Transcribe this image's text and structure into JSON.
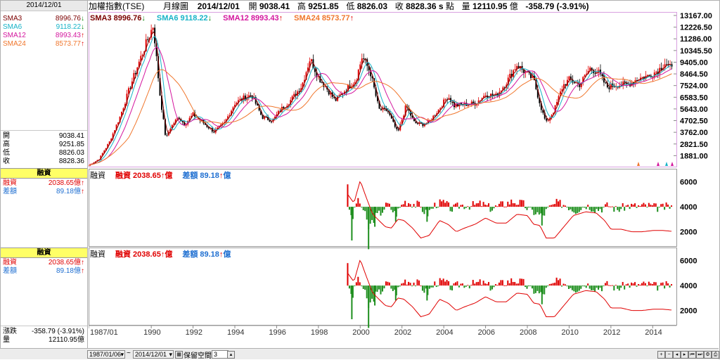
{
  "header": {
    "title": "加權指數(TSE)",
    "period": "月線圖",
    "date": "2014/12/01",
    "open_label": "開",
    "open": "9038.41",
    "high_label": "高",
    "high": "9251.85",
    "low_label": "低",
    "low": "8826.03",
    "close_label": "收",
    "close": "8828.36",
    "close_flag": "s",
    "unit": "點",
    "vol_label": "量",
    "vol": "12110.95",
    "vol_unit": "億",
    "change": "-358.79 (-3.91%)"
  },
  "legend_price": [
    {
      "label": "SMA3",
      "value": "8996.76",
      "dir": "down",
      "color": "#7b0000"
    },
    {
      "label": "SMA6",
      "value": "9118.22",
      "dir": "down",
      "color": "#17b3c7"
    },
    {
      "label": "SMA12",
      "value": "8993.43",
      "dir": "up",
      "color": "#d4169e"
    },
    {
      "label": "SMA24",
      "value": "8573.77",
      "dir": "up",
      "color": "#f0762c"
    }
  ],
  "left_panel": {
    "date": "2014/12/01",
    "sma": [
      {
        "label": "SMA3",
        "value": "8996.76",
        "dir": "down",
        "color": "#7b0000"
      },
      {
        "label": "SMA6",
        "value": "9118.22",
        "dir": "down",
        "color": "#17b3c7"
      },
      {
        "label": "SMA12",
        "value": "8993.43",
        "dir": "up",
        "color": "#d4169e"
      },
      {
        "label": "SMA24",
        "value": "8573.77",
        "dir": "up",
        "color": "#f0762c"
      }
    ],
    "ohlc": [
      {
        "label": "開",
        "value": "9038.41"
      },
      {
        "label": "高",
        "value": "9251.85"
      },
      {
        "label": "低",
        "value": "8826.03"
      },
      {
        "label": "收",
        "value": "8828.36"
      }
    ],
    "margin_box": "融資",
    "margin_rows": [
      {
        "label": "融資",
        "value": "2038.65億",
        "dir": "up",
        "color": "#e00000"
      },
      {
        "label": "差額",
        "value": "89.18億",
        "dir": "up",
        "color": "#1f6fd1"
      }
    ],
    "change_label": "漲跌",
    "change_value": "-358.79 (-3.91%)",
    "vol_label": "量",
    "vol_value": "12110.95億"
  },
  "sub_legend": {
    "name": "融資",
    "item1_label": "融資",
    "item1_value": "2038.65",
    "item2_label": "差額",
    "item2_value": "89.18",
    "unit": "億"
  },
  "price_axis": [
    "13167.00",
    "12226.50",
    "11286.00",
    "10345.50",
    "9405.00",
    "8464.50",
    "7524.00",
    "6583.50",
    "5643.00",
    "4702.50",
    "3762.00",
    "2821.50",
    "1881.00"
  ],
  "sub_axis": [
    "6000",
    "4000",
    "2000"
  ],
  "x_axis": [
    "1987/01",
    "1990",
    "1992",
    "1994",
    "1996",
    "1998",
    "2000",
    "2002",
    "2004",
    "2006",
    "2008",
    "2010",
    "2012",
    "2014"
  ],
  "bottom_bar": {
    "start_date": "1987/01/06",
    "sep": "~",
    "end_date": "2014/12/01",
    "space_label": "保留空間",
    "space_value": "3"
  },
  "chart_data": [
    {
      "type": "candlestick",
      "title": "加權指數(TSE) 月線圖",
      "ylim": [
        940,
        13450
      ],
      "x_range": [
        "1987/01",
        "2014/12"
      ],
      "series": [
        {
          "name": "price_close",
          "x": [
            1987.0,
            1987.5,
            1988.0,
            1988.5,
            1989.0,
            1989.5,
            1990.1,
            1990.4,
            1990.7,
            1990.9,
            1991.3,
            1991.6,
            1992.0,
            1992.5,
            1993.0,
            1993.5,
            1994.0,
            1994.4,
            1994.8,
            1995.3,
            1995.8,
            1996.2,
            1996.7,
            1997.2,
            1997.6,
            1998.0,
            1998.4,
            1998.8,
            1999.3,
            1999.8,
            2000.1,
            2000.5,
            2000.9,
            2001.3,
            2001.8,
            2002.2,
            2002.6,
            2003.0,
            2003.3,
            2003.8,
            2004.2,
            2004.5,
            2005.0,
            2005.5,
            2006.0,
            2006.5,
            2007.0,
            2007.5,
            2007.9,
            2008.3,
            2008.7,
            2008.9,
            2009.3,
            2009.7,
            2010.0,
            2010.5,
            2011.0,
            2011.4,
            2011.8,
            2012.3,
            2012.8,
            2013.3,
            2013.8,
            2014.3,
            2014.6,
            2014.9
          ],
          "values": [
            1100,
            1600,
            3000,
            5000,
            7500,
            9800,
            12400,
            7000,
            3200,
            4100,
            5000,
            4400,
            5200,
            4500,
            3800,
            4500,
            6100,
            6500,
            6800,
            5000,
            4700,
            5600,
            6400,
            7500,
            9700,
            8200,
            7300,
            6300,
            7200,
            8000,
            9900,
            8500,
            5600,
            5500,
            3700,
            5900,
            4500,
            4400,
            4600,
            5700,
            6700,
            5900,
            6000,
            6100,
            6800,
            6700,
            7800,
            9200,
            8600,
            8000,
            5500,
            4500,
            5600,
            7500,
            8000,
            7600,
            8900,
            8600,
            7400,
            7600,
            7600,
            8100,
            8300,
            8800,
            9400,
            8828
          ]
        },
        {
          "name": "SMA3",
          "final": "8996.76"
        },
        {
          "name": "SMA6",
          "final": "9118.22"
        },
        {
          "name": "SMA12",
          "final": "8993.43"
        },
        {
          "name": "SMA24",
          "final": "8573.77"
        }
      ],
      "yticks": [
        13167.0,
        12226.5,
        11286.0,
        10345.5,
        9405.0,
        8464.5,
        7524.0,
        6583.5,
        5643.0,
        4702.5,
        3762.0,
        2821.5,
        1881.0
      ]
    },
    {
      "type": "bar+line",
      "title": "融資",
      "ylim": [
        1300,
        6600
      ],
      "baseline": 4000,
      "line": {
        "name": "融資",
        "x": [
          1999.4,
          1999.7,
          2000.0,
          2000.3,
          2000.6,
          2000.9,
          2001.2,
          2001.5,
          2001.8,
          2002.1,
          2002.5,
          2002.9,
          2003.3,
          2003.8,
          2004.2,
          2004.6,
          2005.0,
          2005.5,
          2006.0,
          2006.5,
          2007.0,
          2007.5,
          2008.0,
          2008.3,
          2008.6,
          2008.9,
          2009.3,
          2009.7,
          2010.2,
          2010.8,
          2011.3,
          2011.7,
          2012.0,
          2012.5,
          2013.0,
          2013.5,
          2014.0,
          2014.5,
          2014.9
        ],
        "values": [
          5000,
          4300,
          6100,
          4700,
          3400,
          2900,
          2400,
          2300,
          3000,
          2900,
          2300,
          1500,
          1700,
          2900,
          2600,
          2000,
          2300,
          2600,
          3100,
          2700,
          2700,
          3400,
          3300,
          2600,
          2500,
          1500,
          1500,
          2300,
          3300,
          3600,
          3500,
          2900,
          2200,
          2200,
          2000,
          2000,
          2100,
          2100,
          2038.65
        ]
      },
      "bars": {
        "name": "差額",
        "x": [
          1999.4,
          1999.6,
          1999.8,
          2000.0,
          2000.2,
          2000.4,
          2000.7,
          2001.0,
          2001.3,
          2001.7,
          2002.1,
          2002.4,
          2002.8,
          2003.2,
          2003.6,
          2004.0,
          2004.4,
          2004.8,
          2005.3,
          2005.8,
          2006.3,
          2006.8,
          2007.3,
          2007.8,
          2008.1,
          2008.4,
          2008.7,
          2009.0,
          2009.4,
          2009.8,
          2010.3,
          2010.8,
          2011.3,
          2011.6,
          2011.9,
          2012.3,
          2012.8,
          2013.3,
          2013.8,
          2014.3,
          2014.8
        ],
        "values": [
          1800,
          -2700,
          900,
          600,
          -900,
          -3400,
          -1600,
          -900,
          500,
          -1200,
          900,
          700,
          300,
          -1200,
          400,
          700,
          -400,
          300,
          200,
          500,
          -300,
          400,
          900,
          500,
          -600,
          -900,
          -1500,
          -300,
          600,
          400,
          -600,
          300,
          -400,
          -200,
          300,
          -500,
          200,
          100,
          200,
          -200,
          89.18
        ]
      }
    }
  ]
}
